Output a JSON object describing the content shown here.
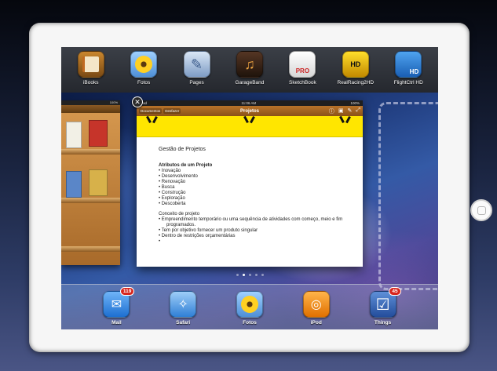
{
  "multitask_apps": [
    {
      "label": "iBooks",
      "icon": "ibooks-icon"
    },
    {
      "label": "Fotos",
      "icon": "photos-icon"
    },
    {
      "label": "Pages",
      "icon": "pages-icon"
    },
    {
      "label": "GarageBand",
      "icon": "garageband-icon"
    },
    {
      "label": "SketchBook",
      "icon": "sketchbook-icon",
      "icon_text": "PRO"
    },
    {
      "label": "RealRacing2HD",
      "icon": "realracing-icon",
      "icon_text": "HD"
    },
    {
      "label": "FlightCtrl HD",
      "icon": "flightcontrol-icon",
      "icon_text": "HD"
    }
  ],
  "books_card": {
    "status_text": "100%"
  },
  "main_card": {
    "status": {
      "left": "iPad",
      "center": "11:06 AM",
      "right": "100%"
    },
    "nav": {
      "left_buttons": [
        "Documentos",
        "Desfazer"
      ],
      "title": "Projetos"
    },
    "document": {
      "title": "Gestão de Projetos",
      "section1_heading": "Atributos de um Projeto",
      "section1_items": [
        "Inovação",
        "Desenvolvimento",
        "Renovação",
        "Busca",
        "Construção",
        "Exploração",
        "Descoberta"
      ],
      "section2_heading": "Conceito de projeto",
      "section2_items": [
        "Empreendimento temporário ou uma sequência de atividades com começo, meio e fim",
        "programados.",
        "Tem por objetivo fornecer um produto singular",
        "Dentro de restrições orçamentárias",
        ""
      ]
    }
  },
  "dock_apps": [
    {
      "label": "Mail",
      "icon": "mail-icon",
      "badge": "119"
    },
    {
      "label": "Safari",
      "icon": "safari-icon"
    },
    {
      "label": "Fotos",
      "icon": "photos-icon"
    },
    {
      "label": "iPod",
      "icon": "ipod-icon"
    },
    {
      "label": "Things",
      "icon": "things-icon",
      "badge": "45"
    }
  ],
  "page_dots": {
    "count": 5,
    "active_index": 1
  }
}
